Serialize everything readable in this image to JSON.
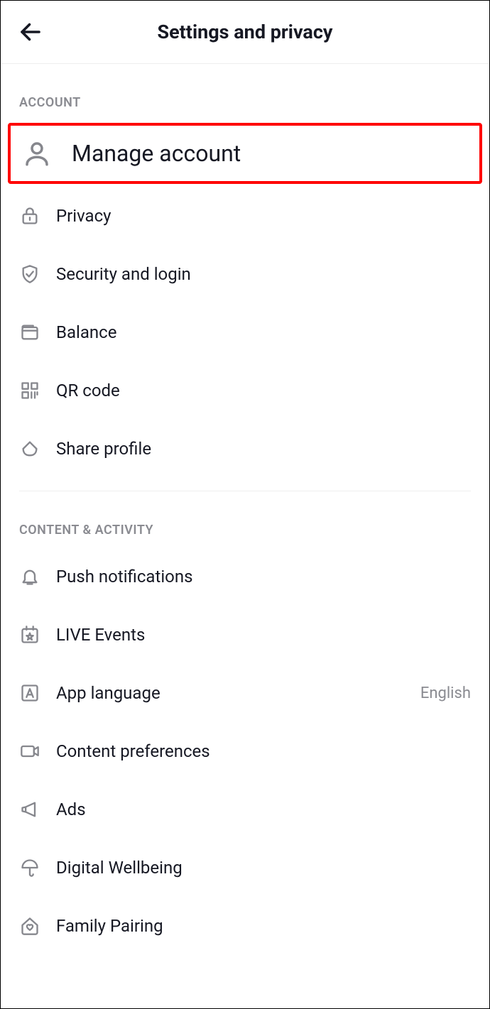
{
  "header": {
    "title": "Settings and privacy"
  },
  "sections": {
    "account": {
      "title": "ACCOUNT",
      "items": {
        "manage_account": "Manage account",
        "privacy": "Privacy",
        "security": "Security and login",
        "balance": "Balance",
        "qr_code": "QR code",
        "share_profile": "Share profile"
      }
    },
    "content": {
      "title": "CONTENT & ACTIVITY",
      "items": {
        "push_notifications": "Push notifications",
        "live_events": "LIVE Events",
        "app_language": "App language",
        "app_language_value": "English",
        "content_preferences": "Content preferences",
        "ads": "Ads",
        "digital_wellbeing": "Digital Wellbeing",
        "family_pairing": "Family Pairing"
      }
    }
  }
}
